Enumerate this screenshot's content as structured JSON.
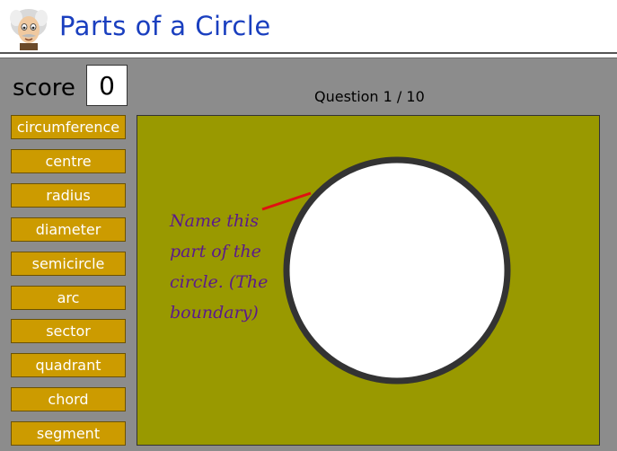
{
  "header": {
    "title": "Parts of a Circle",
    "mascot_icon": "einstein-avatar-icon"
  },
  "score": {
    "label": "score",
    "value": "0"
  },
  "question": {
    "counter": "Question 1 / 10",
    "prompt": "Name this part of the circle. (The boundary)"
  },
  "answers": [
    "circumference",
    "centre",
    "radius",
    "diameter",
    "semicircle",
    "arc",
    "sector",
    "quadrant",
    "chord",
    "segment"
  ],
  "colors": {
    "title": "#1a3fbf",
    "button": "#cc9b00",
    "board": "#999900",
    "panel": "#8c8c8c",
    "prompt": "#5b1a8c",
    "pointer": "#e01010",
    "circle_stroke": "#333333"
  }
}
